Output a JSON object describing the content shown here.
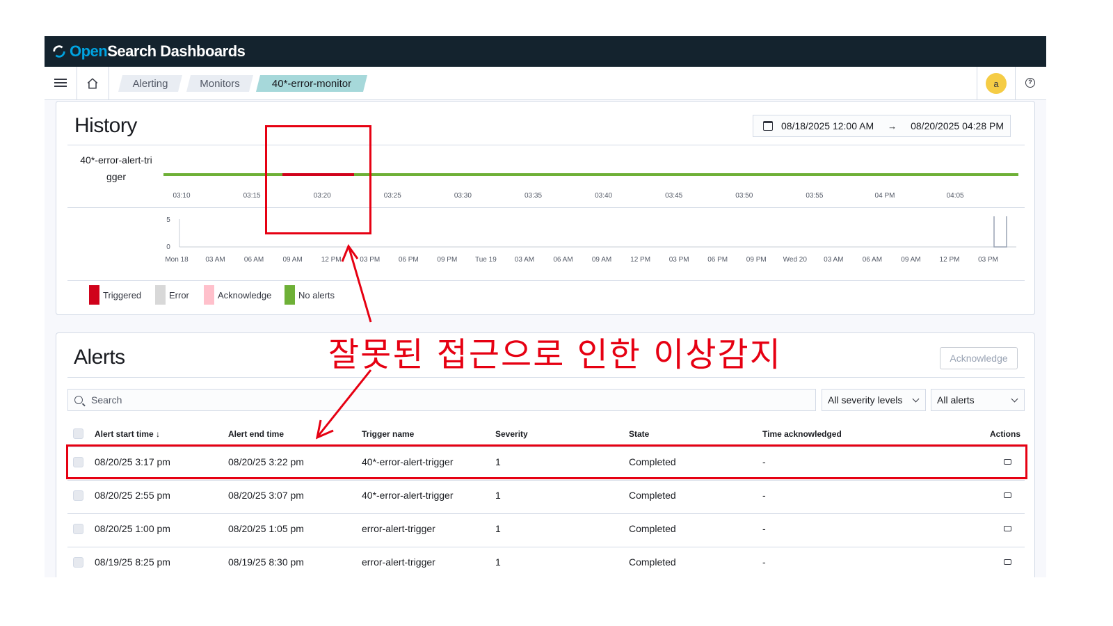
{
  "header": {
    "brand_open": "Open",
    "brand_rest": "Search Dashboards"
  },
  "breadcrumbs": [
    {
      "label": "Alerting"
    },
    {
      "label": "Monitors"
    },
    {
      "label": "40*-error-monitor"
    }
  ],
  "user": {
    "avatar_initial": "a"
  },
  "history": {
    "title": "History",
    "date_start": "08/18/2025 12:00 AM",
    "date_arrow": "→",
    "date_end": "08/20/2025 04:28 PM",
    "trigger_label": "40*-error-alert-tri gger",
    "timeline_ticks": [
      "03:10",
      "03:15",
      "03:20",
      "03:25",
      "03:30",
      "03:35",
      "03:40",
      "03:45",
      "03:50",
      "03:55",
      "04 PM",
      "04:05"
    ],
    "y_ticks": [
      "5",
      "0"
    ],
    "overview_ticks": [
      "Mon 18",
      "03 AM",
      "06 AM",
      "09 AM",
      "12 PM",
      "03 PM",
      "06 PM",
      "09 PM",
      "Tue 19",
      "03 AM",
      "06 AM",
      "09 AM",
      "12 PM",
      "03 PM",
      "06 PM",
      "09 PM",
      "Wed 20",
      "03 AM",
      "06 AM",
      "09 AM",
      "12 PM",
      "03 PM"
    ],
    "legend": [
      {
        "label": "Triggered",
        "color": "#d0021b"
      },
      {
        "label": "Error",
        "color": "#d8d8d8"
      },
      {
        "label": "Acknowledge",
        "color": "#ffc0cb"
      },
      {
        "label": "No alerts",
        "color": "#6eb037"
      }
    ]
  },
  "alerts": {
    "title": "Alerts",
    "acknowledge_label": "Acknowledge",
    "search_placeholder": "Search",
    "severity_select": "All severity levels",
    "state_select": "All alerts",
    "columns": {
      "start": "Alert start time",
      "end": "Alert end time",
      "trigger": "Trigger name",
      "severity": "Severity",
      "state": "State",
      "ack": "Time acknowledged",
      "actions": "Actions"
    },
    "rows": [
      {
        "start": "08/20/25 3:17 pm",
        "end": "08/20/25 3:22 pm",
        "trigger": "40*-error-alert-trigger",
        "severity": "1",
        "state": "Completed",
        "ack": "-"
      },
      {
        "start": "08/20/25 2:55 pm",
        "end": "08/20/25 3:07 pm",
        "trigger": "40*-error-alert-trigger",
        "severity": "1",
        "state": "Completed",
        "ack": "-"
      },
      {
        "start": "08/20/25 1:00 pm",
        "end": "08/20/25 1:05 pm",
        "trigger": "error-alert-trigger",
        "severity": "1",
        "state": "Completed",
        "ack": "-"
      },
      {
        "start": "08/19/25 8:25 pm",
        "end": "08/19/25 8:30 pm",
        "trigger": "error-alert-trigger",
        "severity": "1",
        "state": "Completed",
        "ack": "-"
      }
    ]
  },
  "annotation": {
    "text": "잘못된 접근으로 인한 이상감지"
  }
}
